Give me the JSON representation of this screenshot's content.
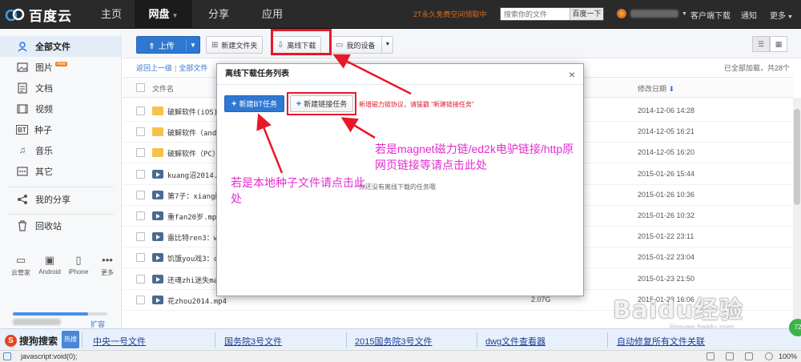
{
  "app": {
    "logo_text": "百度云"
  },
  "nav": {
    "tabs": [
      {
        "label": "主页"
      },
      {
        "label": "网盘"
      },
      {
        "label": "分享"
      },
      {
        "label": "应用"
      }
    ],
    "promo": "2T永久免费空间领取中",
    "search_placeholder": "搜索你的文件",
    "search_button": "百度一下",
    "menu": [
      "客户端下载",
      "通知",
      "更多"
    ]
  },
  "sidebar": {
    "items": [
      {
        "label": "全部文件",
        "icon": "doc-icon"
      },
      {
        "label": "图片",
        "icon": "image-icon",
        "badge": "new"
      },
      {
        "label": "文档",
        "icon": "document-icon"
      },
      {
        "label": "视频",
        "icon": "video-icon"
      },
      {
        "label": "种子",
        "icon": "bt-icon"
      },
      {
        "label": "音乐",
        "icon": "music-icon"
      },
      {
        "label": "其它",
        "icon": "more-icon"
      }
    ],
    "share": "我的分享",
    "recycle": "回收站",
    "devices": [
      "云管家",
      "Android",
      "iPhone",
      "更多"
    ],
    "expand": "扩容",
    "quota_fraction": 0.8
  },
  "toolbar": {
    "upload": "上传",
    "new_folder": "新建文件夹",
    "offline_download": "离线下载",
    "my_device": "我的设备"
  },
  "breadcrumb": {
    "back": "返回上一级",
    "all": "全部文件"
  },
  "loaded_text": "已全部加载，共28个",
  "columns": {
    "name": "文件名",
    "date": "修改日期"
  },
  "files": [
    {
      "name": "破解软件(iOS)",
      "type": "folder",
      "size": "",
      "date": "2014-12-06 14:28"
    },
    {
      "name": "破解软件（andr",
      "type": "folder",
      "size": "",
      "date": "2014-12-05 16:21"
    },
    {
      "name": "破解软件（PC）",
      "type": "folder",
      "size": "",
      "date": "2014-12-05 16:20"
    },
    {
      "name": "kuang沼2014.m",
      "type": "video",
      "size": "",
      "date": "2015-01-26 15:44"
    },
    {
      "name": "第7子：xiang醒",
      "type": "video",
      "size": "",
      "date": "2015-01-26 10:36"
    },
    {
      "name": "重fan20岁.mp4",
      "type": "video",
      "size": "",
      "date": "2015-01-26 10:32"
    },
    {
      "name": "雷比特ren3：w",
      "type": "video",
      "size": "",
      "date": "2015-01-22 23:11"
    },
    {
      "name": "饥饿you戏3：c",
      "type": "video",
      "size": "",
      "date": "2015-01-22 23:04"
    },
    {
      "name": "还魂zhi迷失man谷.mkv",
      "type": "video",
      "size": "750.7M",
      "date": "2015-01-23 21:50"
    },
    {
      "name": "花zhou2014.mp4",
      "type": "video",
      "size": "2.07G",
      "date": "2015-01-23 16:06"
    }
  ],
  "modal": {
    "title": "离线下载任务列表",
    "new_bt": "新建BT任务",
    "new_link": "新建链接任务",
    "hint": "新增磁力链协议，请猛戳 \"新建链接任务\"",
    "empty": "你还没有离线下载的任务哦"
  },
  "annotations": {
    "bt_note": "若是本地种子文件请点击此处",
    "link_note": "若是magnet磁力链/ed2k电驴链接/http原网页链接等请点击此处"
  },
  "sogou": {
    "logo": "搜狗搜索",
    "hot": "热搜",
    "links": [
      "中央一号文件",
      "国务院3号文件",
      "2015国务院3号文件",
      "dwg文件查看器",
      "自动修复所有文件关联"
    ]
  },
  "status": {
    "url": "javascript:void(0);",
    "zoom": "100%"
  },
  "watermark": {
    "main": "Baidu经验",
    "sub": "jingyan.baidu.com"
  }
}
